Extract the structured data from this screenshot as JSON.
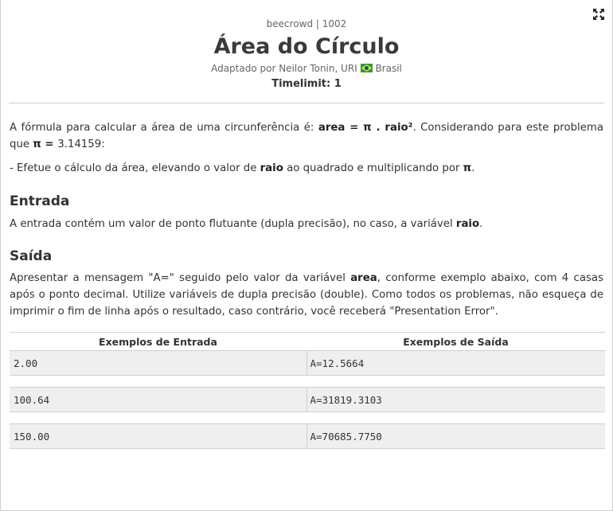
{
  "problem": {
    "source": "beecrowd | 1002",
    "title": "Área do Círculo",
    "author_prefix": "Adaptado por Neilor Tonin, URI",
    "country": "Brasil",
    "timelimit": "Timelimit: 1"
  },
  "description": {
    "p1_a": "A fórmula para calcular a área de uma circunferência é: ",
    "p1_formula": "area = π . raio²",
    "p1_b": ". Considerando para este problema que ",
    "p1_pi": "π = ",
    "p1_c": "3.14159:",
    "p2_a": "- Efetue o cálculo da área, elevando o valor de ",
    "p2_raio": "raio",
    "p2_b": " ao quadrado e multiplicando por ",
    "p2_pi": "π",
    "p2_c": "."
  },
  "input_section": {
    "heading": "Entrada",
    "text_a": "A entrada contém um valor de ponto flutuante (dupla precisão), no caso, a variável ",
    "text_var": "raio",
    "text_b": "."
  },
  "output_section": {
    "heading": "Saída",
    "text_a": "Apresentar a mensagem \"A=\" seguido pelo valor da variável ",
    "text_var": "area",
    "text_b": ", conforme exemplo abaixo, com 4 casas após o ponto decimal. Utilize variáveis de dupla precisão (double). Como todos os problemas, não esqueça de imprimir o fim de linha após o resultado, caso contrário, você receberá \"Presentation Error\"."
  },
  "samples": {
    "header_input": "Exemplos de Entrada",
    "header_output": "Exemplos de Saída",
    "rows": [
      {
        "input": "2.00",
        "output": "A=12.5664"
      },
      {
        "input": "100.64",
        "output": "A=31819.3103"
      },
      {
        "input": "150.00",
        "output": "A=70685.7750"
      }
    ]
  },
  "icons": {
    "expand": "expand-icon",
    "flag": "brazil-flag-icon"
  },
  "colors": {
    "text": "#333333",
    "sample_bg": "#efefef",
    "border": "#cfcfcf",
    "flag_green": "#229e45",
    "flag_yellow": "#f8e509",
    "flag_blue": "#2b49a3"
  }
}
